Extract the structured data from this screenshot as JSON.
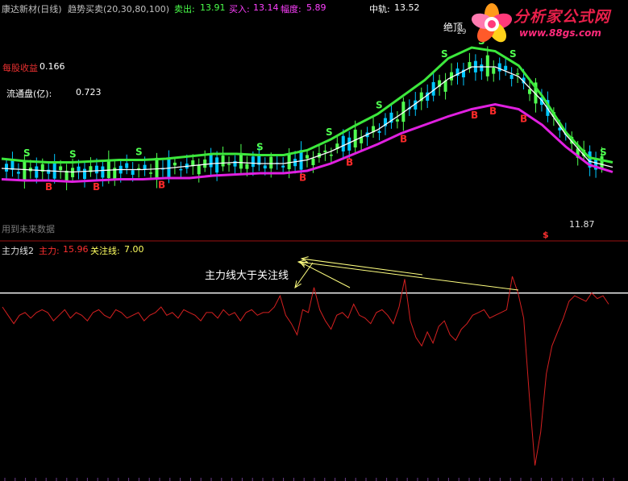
{
  "header": {
    "stock": "康达新材(日线)",
    "indicator": "趋势买卖(20,30,80,100)",
    "sell_label": "卖出:",
    "sell_value": "13.91",
    "buy_label": "买入:",
    "buy_value": "13.14",
    "range_label": "幅度:",
    "range_value": "5.89",
    "mid_label": "中轨:",
    "mid_value": "13.52"
  },
  "upper_panel": {
    "eps_label": "每股收益",
    "eps_value": "0.166",
    "float_label": "流通盘(亿):",
    "float_value": "0.723",
    "future_note": "用到未来数据",
    "top_label": "绝顶",
    "top_value": "29",
    "low_price": "11.87",
    "signal_s": "S",
    "signal_b": "B",
    "bottom_marker": "$"
  },
  "lower_panel": {
    "title": "主力线2",
    "main_label": "主力:",
    "main_value": "15.96",
    "focus_label": "关注线:",
    "focus_value": "7.00",
    "annotation": "主力线大于关注线"
  },
  "logo": {
    "name": "分析家公式网",
    "url": "www.88gs.com"
  },
  "colors": {
    "upper_band": "#3ce83c",
    "lower_band": "#e020e0",
    "mid_line": "#ffffff",
    "up_candle": "#50ff50",
    "down_candle": "#00c8ff",
    "main_line": "#d42020",
    "focus_line": "#ffffff",
    "annotation": "#ffff80",
    "separator": "#9a1010"
  },
  "chart_data": [
    {
      "type": "line",
      "panel": "upper",
      "series": [
        {
          "values": [
            14.2,
            14.0,
            13.9,
            13.9,
            14.0,
            14.1,
            14.1,
            14.2,
            14.4,
            14.6,
            14.6,
            14.5,
            14.5,
            14.9,
            15.8,
            16.9,
            17.9,
            19.3,
            20.7,
            22.5,
            23.4,
            23.1,
            21.9,
            19.4,
            16.4,
            14.3,
            13.9
          ]
        },
        {
          "values": [
            13.4,
            13.3,
            13.2,
            13.1,
            13.2,
            13.3,
            13.3,
            13.4,
            13.6,
            13.8,
            13.9,
            13.8,
            13.8,
            14.1,
            14.8,
            15.7,
            16.6,
            17.9,
            19.3,
            20.8,
            21.8,
            21.8,
            21.0,
            19.0,
            16.2,
            14.0,
            13.5
          ]
        },
        {
          "values": [
            12.5,
            12.4,
            12.4,
            12.3,
            12.4,
            12.5,
            12.5,
            12.6,
            12.6,
            12.8,
            12.9,
            13.0,
            13.0,
            13.2,
            13.8,
            14.6,
            15.4,
            16.3,
            17.0,
            17.7,
            18.3,
            18.7,
            18.3,
            17.0,
            15.2,
            13.7,
            13.1
          ]
        }
      ]
    },
    {
      "type": "line",
      "panel": "lower",
      "series": [
        {
          "values": [
            2,
            -1,
            -4,
            -1,
            0,
            -2,
            0,
            1,
            0,
            -3,
            -1,
            1,
            -2,
            0,
            -1,
            -3,
            0,
            1,
            -1,
            -2,
            1,
            0,
            -2,
            -1,
            0,
            -3,
            -1,
            0,
            2,
            -1,
            0,
            -2,
            1,
            0,
            -1,
            -3,
            0,
            0,
            -2,
            1,
            -1,
            0,
            -3,
            0,
            1,
            -1,
            0,
            0,
            2,
            6,
            -1,
            -4,
            -8,
            1,
            0,
            9,
            1,
            -3,
            -6,
            -1,
            0,
            -2,
            3,
            -1,
            -2,
            -4,
            0,
            1,
            -1,
            -4,
            2,
            12,
            -3,
            -9,
            -12,
            -7,
            -11,
            -5,
            -3,
            -8,
            -10,
            -6,
            -4,
            -1,
            0,
            1,
            -2,
            -1,
            0,
            1,
            13,
            7,
            -2,
            -30,
            -55,
            -43,
            -22,
            -12,
            -7,
            -2,
            4,
            6,
            5,
            4,
            7,
            5,
            6,
            3
          ]
        },
        {
          "values": [
            7.0
          ]
        }
      ]
    }
  ]
}
